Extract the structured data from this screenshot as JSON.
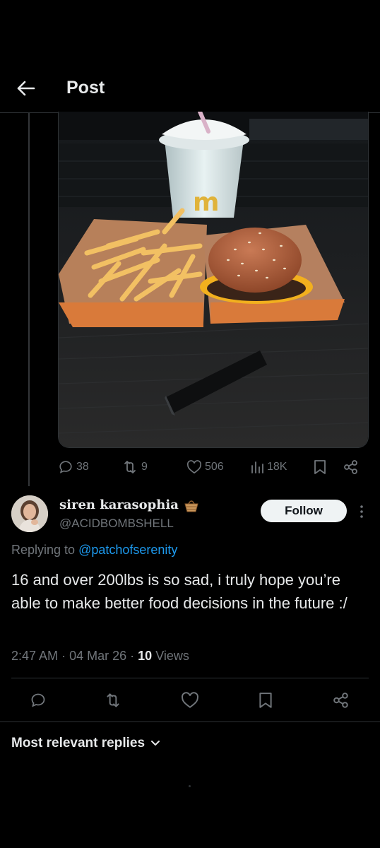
{
  "header": {
    "title": "Post"
  },
  "quoted_post": {
    "image_alt": "food-photo",
    "stats": {
      "replies": "38",
      "reposts": "9",
      "likes": "506",
      "views": "18K"
    }
  },
  "reply": {
    "display_name": "siren karasophia",
    "handle": "@ACIDBOMBSHELL",
    "follow_label": "Follow",
    "replying_prefix": "Replying to ",
    "replying_to": "@patchofserenity",
    "text": "16 and over 200lbs is so sad, i truly hope you’re able to make better food decisions in the future :/",
    "time": "2:47 AM",
    "date": "04 Mar 26",
    "views_count": "10",
    "views_label": "Views",
    "separator": "·"
  },
  "sort": {
    "label": "Most relevant replies"
  },
  "colors": {
    "background": "#000000",
    "text": "#e7e9ea",
    "muted": "#71767b",
    "link": "#1d9bf0",
    "border": "#2f3336"
  }
}
